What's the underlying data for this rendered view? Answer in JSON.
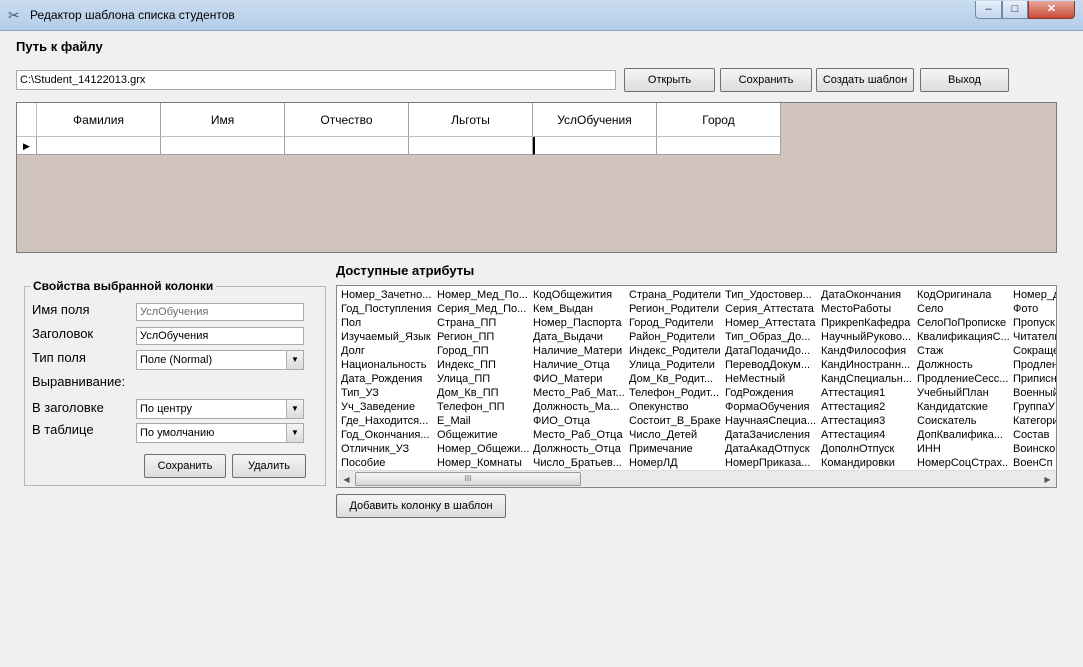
{
  "window": {
    "title": "Редактор шаблона списка студентов",
    "min_label": "–",
    "max_label": "□",
    "close_label": "✕"
  },
  "path": {
    "label": "Путь к файлу",
    "value": "C:\\Student_14122013.grx"
  },
  "toolbar": {
    "open_label": "Открыть",
    "save_label": "Сохранить",
    "create_label": "Создать шаблон",
    "exit_label": "Выход"
  },
  "grid": {
    "columns": [
      "Фамилия",
      "Имя",
      "Отчество",
      "Льготы",
      "УслОбучения",
      "Город"
    ],
    "row_marker": "▶"
  },
  "props": {
    "title": "Свойства выбранной колонки",
    "field_name_label": "Имя поля",
    "field_name_value": "УслОбучения",
    "header_label": "Заголовок",
    "header_value": "УслОбучения",
    "type_label": "Тип поля",
    "type_value": "Поле (Normal)",
    "align_label": "Выравнивание:",
    "align_header_label": "В заголовке",
    "align_header_value": "По центру",
    "align_table_label": "В таблице",
    "align_table_value": "По умолчанию",
    "save_label": "Сохранить",
    "delete_label": "Удалить"
  },
  "attrs": {
    "title": "Доступные атрибуты",
    "add_label": "Добавить колонку в шаблон",
    "columns": [
      [
        "Номер_Зачетно...",
        "Год_Поступления",
        "Пол",
        "Изучаемый_Язык",
        "Долг",
        "Национальность",
        "Дата_Рождения",
        "Тип_УЗ",
        "Уч_Заведение",
        "Где_Находится...",
        "Год_Окончания...",
        "Отличник_УЗ",
        "Пособие"
      ],
      [
        "Номер_Мед_По...",
        "Серия_Мед_По...",
        "Страна_ПП",
        "Регион_ПП",
        "Город_ПП",
        "Индекс_ПП",
        "Улица_ПП",
        "Дом_Кв_ПП",
        "Телефон_ПП",
        "E_Mail",
        "Общежитие",
        "Номер_Общежи...",
        "Номер_Комнаты"
      ],
      [
        "КодОбщежития",
        "Кем_Выдан",
        "Номер_Паспорта",
        "Дата_Выдачи",
        "Наличие_Матери",
        "Наличие_Отца",
        "ФИО_Матери",
        "Место_Раб_Мат...",
        "Должность_Ма...",
        "ФИО_Отца",
        "Место_Раб_Отца",
        "Должность_Отца",
        "Число_Братьев..."
      ],
      [
        "Страна_Родители",
        "Регион_Родители",
        "Город_Родители",
        "Район_Родители",
        "Индекс_Родители",
        "Улица_Родители",
        "Дом_Кв_Родит...",
        "Телефон_Родит...",
        "Опекунство",
        "Состоит_В_Браке",
        "Число_Детей",
        "Примечание",
        "НомерЛД"
      ],
      [
        "Тип_Удостовер...",
        "Серия_Аттестата",
        "Номер_Аттестата",
        "Тип_Образ_До...",
        "ДатаПодачиДо...",
        "ПереводДокум...",
        "НеМестный",
        "ГодРождения",
        "ФормаОбучения",
        "НаучнаяСпециа...",
        "ДатаЗачисления",
        "ДатаАкадОтпуск",
        "НомерПриказа..."
      ],
      [
        "ДатаОкончания",
        "МестоРаботы",
        "ПрикрепКафедра",
        "НаучныйРуково...",
        "КандФилософия",
        "КандИностранн...",
        "КандСпециальн...",
        "Аттестация1",
        "Аттестация2",
        "Аттестация3",
        "Аттестация4",
        "ДополнОтпуск",
        "Командировки"
      ],
      [
        "КодОригинала",
        "Село",
        "СелоПоПрописке",
        "КвалификацияС...",
        "Стаж",
        "Должность",
        "ПродлениеСесс...",
        "УчебныйПлан",
        "Кандидатские",
        "Соискатель",
        "ДопКвалифика...",
        "ИНН",
        "НомерСоцСтрах..."
      ],
      [
        "Номер_д",
        "Фото",
        "Пропуск",
        "Читатель",
        "Сокраще",
        "Продлен",
        "Приписн",
        "Военный",
        "ГруппаУ",
        "Категори",
        "Состав",
        "Воинско",
        "ВоенСп"
      ]
    ],
    "scroll_left": "◀",
    "scroll_thumb": "III",
    "scroll_right": "▶"
  },
  "icons": {
    "app_icon": "tools-icon",
    "dropdown": "▼"
  }
}
